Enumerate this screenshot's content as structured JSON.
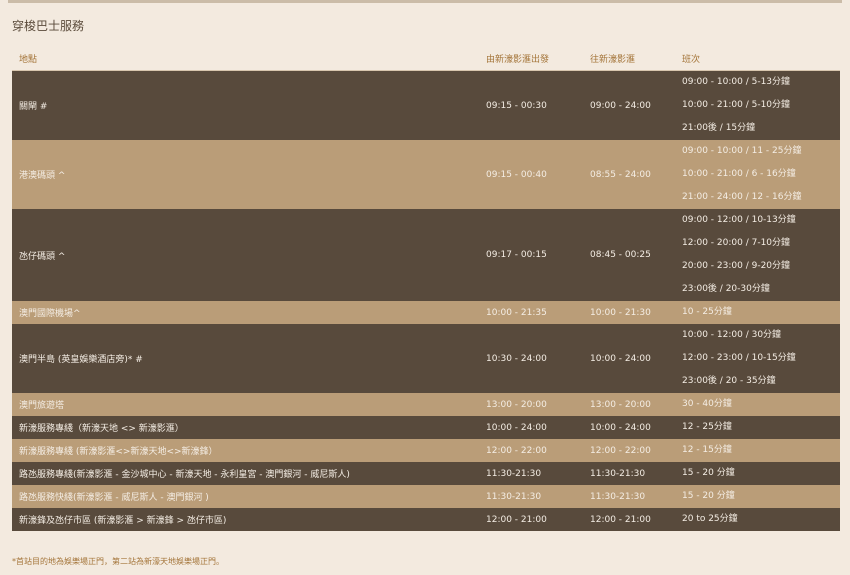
{
  "page": {
    "section_title": "穿梭巴士服務",
    "footnote": "*首站目的地為娛樂場正門，第二站為新濠天地娛樂場正門。"
  },
  "table": {
    "headers": [
      "地點",
      "由新濠影滙出發",
      "往新濠影滙",
      "班次"
    ],
    "rows": [
      {
        "location": "關閘 #",
        "depart": "09:15 - 00:30",
        "arrive": "09:00 - 24:00",
        "schedule": [
          "09:00 - 10:00 / 5-13分鐘",
          "10:00 - 21:00 / 5-10分鐘",
          "21:00後 / 15分鐘"
        ],
        "shade": "dark"
      },
      {
        "location": "港澳碼頭 ^",
        "depart": "09:15 - 00:40",
        "arrive": "08:55 - 24:00",
        "schedule": [
          "09:00 - 10:00 / 11 - 25分鐘",
          "10:00 - 21:00 / 6 - 16分鐘",
          "21:00 - 24:00 / 12 - 16分鐘"
        ],
        "shade": "light"
      },
      {
        "location": "氹仔碼頭 ^",
        "depart": "09:17 - 00:15",
        "arrive": "08:45 - 00:25",
        "schedule": [
          "09:00 - 12:00 / 10-13分鐘",
          "12:00 - 20:00 / 7-10分鐘",
          "20:00 - 23:00 / 9-20分鐘",
          "23:00後 / 20-30分鐘"
        ],
        "shade": "dark"
      },
      {
        "location": "澳門國際機場^",
        "depart": "10:00 - 21:35",
        "arrive": "10:00 - 21:30",
        "schedule": [
          "10 - 25分鐘"
        ],
        "shade": "light"
      },
      {
        "location": "澳門半島 (英皇娛樂酒店旁)* #",
        "depart": "10:30 - 24:00",
        "arrive": "10:00 - 24:00",
        "schedule": [
          "10:00 - 12:00 / 30分鐘",
          "12:00 - 23:00 / 10-15分鐘",
          "23:00後 / 20 - 35分鐘"
        ],
        "shade": "dark"
      },
      {
        "location": "澳門旅遊塔",
        "depart": "13:00 - 20:00",
        "arrive": "13:00 - 20:00",
        "schedule": [
          "30 - 40分鐘"
        ],
        "shade": "light"
      },
      {
        "location": "新濠服務專綫（新濠天地 <> 新濠影滙）",
        "depart": "10:00 - 24:00",
        "arrive": "10:00 - 24:00",
        "schedule": [
          "12 - 25分鐘"
        ],
        "shade": "dark"
      },
      {
        "location": "新濠服務專綫 (新濠影滙<>新濠天地<>新濠鋒）",
        "depart": "12:00 - 22:00",
        "arrive": "12:00 - 22:00",
        "schedule": [
          "12 - 15分鐘"
        ],
        "shade": "light"
      },
      {
        "location": "路氹服務專綫(新濠影滙 - 金沙城中心 - 新濠天地 - 永利皇宮 - 澳門銀河 - 威尼斯人)",
        "depart": "11:30-21:30",
        "arrive": "11:30-21:30",
        "schedule": [
          "15 - 20 分鐘"
        ],
        "shade": "dark"
      },
      {
        "location": "路氹服務快綫(新濠影滙 - 威尼斯人 - 澳門銀河 )",
        "depart": "11:30-21:30",
        "arrive": "11:30-21:30",
        "schedule": [
          "15 - 20 分鐘"
        ],
        "shade": "light"
      },
      {
        "location": "新濠鋒及氹仔市區 (新濠影滙 > 新濠鋒 > 氹仔市區)",
        "depart": "12:00 - 21:00",
        "arrive": "12:00 - 21:00",
        "schedule": [
          "20 to 25分鐘"
        ],
        "shade": "dark"
      }
    ]
  },
  "colors": {
    "background": "#f3eadf",
    "row_dark": "#584a3c",
    "row_light": "#ba9d78",
    "header_text": "#a4753a",
    "row_text": "#f4ede4"
  }
}
